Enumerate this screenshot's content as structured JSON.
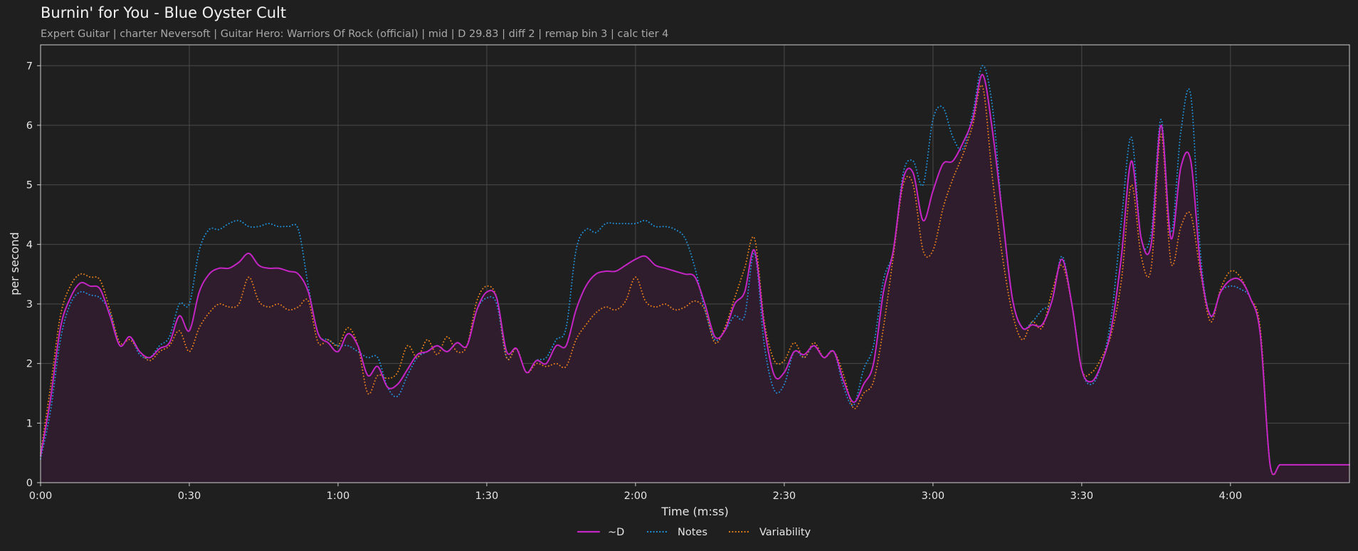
{
  "title": "Burnin' for You - Blue Oyster Cult",
  "subtitle": "Expert Guitar  |  charter Neversoft  |  Guitar Hero: Warriors Of Rock (official)  |  mid  |  D 29.83  |  diff 2  |  remap bin 3  |  calc tier 4",
  "colors": {
    "background": "#1f1f1f",
    "grid": "#4a4a4a",
    "d": "#c425c4",
    "notes": "#1f8fd6",
    "variability": "#e07b1c",
    "fill": "#2f1c2d"
  },
  "chart_data": {
    "type": "line",
    "xlabel": "Time (m:ss)",
    "ylabel": "per second",
    "xlim": [
      0,
      264
    ],
    "ylim": [
      0,
      7.35
    ],
    "x_ticks": [
      0,
      30,
      60,
      90,
      120,
      150,
      180,
      210,
      240
    ],
    "x_tick_labels": [
      "0:00",
      "0:30",
      "1:00",
      "1:30",
      "2:00",
      "2:30",
      "3:00",
      "3:30",
      "4:00"
    ],
    "y_ticks": [
      0,
      1,
      2,
      3,
      4,
      5,
      6,
      7
    ],
    "y_tick_labels": [
      "0",
      "1",
      "2",
      "3",
      "4",
      "5",
      "6",
      "7"
    ],
    "grid": true,
    "legend_position": "bottom-center",
    "x": [
      0,
      2,
      4,
      6,
      8,
      10,
      12,
      14,
      16,
      18,
      20,
      22,
      24,
      26,
      28,
      30,
      32,
      34,
      36,
      38,
      40,
      42,
      44,
      46,
      48,
      50,
      52,
      54,
      56,
      58,
      60,
      62,
      64,
      66,
      68,
      70,
      72,
      74,
      76,
      78,
      80,
      82,
      84,
      86,
      88,
      90,
      92,
      94,
      96,
      98,
      100,
      102,
      104,
      106,
      108,
      110,
      112,
      114,
      116,
      118,
      120,
      122,
      124,
      126,
      128,
      130,
      132,
      134,
      136,
      138,
      140,
      142,
      144,
      146,
      148,
      150,
      152,
      154,
      156,
      158,
      160,
      162,
      164,
      166,
      168,
      170,
      172,
      174,
      176,
      178,
      180,
      182,
      184,
      186,
      188,
      190,
      192,
      194,
      196,
      198,
      200,
      202,
      204,
      206,
      208,
      210,
      212,
      214,
      216,
      218,
      220,
      222,
      224,
      226,
      228,
      230,
      232,
      234,
      236,
      238,
      240,
      242,
      244,
      246,
      248,
      250,
      252,
      254,
      256,
      258,
      260,
      262,
      264
    ],
    "series": [
      {
        "name": "~D",
        "style": "solid",
        "fill": true,
        "values": [
          0.45,
          1.4,
          2.6,
          3.1,
          3.35,
          3.3,
          3.25,
          2.8,
          2.3,
          2.45,
          2.2,
          2.1,
          2.25,
          2.35,
          2.8,
          2.55,
          3.2,
          3.5,
          3.6,
          3.6,
          3.7,
          3.85,
          3.65,
          3.6,
          3.6,
          3.55,
          3.5,
          3.2,
          2.5,
          2.35,
          2.2,
          2.5,
          2.3,
          1.8,
          1.95,
          1.6,
          1.65,
          1.9,
          2.15,
          2.2,
          2.3,
          2.2,
          2.35,
          2.3,
          2.9,
          3.2,
          3.1,
          2.2,
          2.25,
          1.85,
          2.05,
          2.0,
          2.3,
          2.3,
          2.9,
          3.3,
          3.5,
          3.55,
          3.55,
          3.65,
          3.75,
          3.8,
          3.65,
          3.6,
          3.55,
          3.5,
          3.45,
          3.0,
          2.45,
          2.55,
          3.0,
          3.2,
          3.9,
          2.6,
          1.8,
          1.85,
          2.2,
          2.15,
          2.3,
          2.1,
          2.2,
          1.7,
          1.35,
          1.65,
          2.0,
          3.2,
          3.9,
          5.1,
          5.2,
          4.4,
          4.9,
          5.35,
          5.4,
          5.7,
          6.1,
          6.85,
          5.9,
          4.5,
          3.1,
          2.6,
          2.65,
          2.65,
          3.05,
          3.75,
          3.0,
          1.9,
          1.7,
          2.0,
          2.6,
          3.8,
          5.4,
          4.1,
          4.0,
          6.0,
          4.1,
          5.3,
          5.4,
          3.6,
          2.8,
          3.2,
          3.4,
          3.4,
          3.1,
          2.5,
          0.3,
          0.3,
          0.3,
          0.3,
          0.3,
          0.3,
          0.3,
          0.3,
          0.3
        ]
      },
      {
        "name": "Notes",
        "style": "dotted",
        "values": [
          0.4,
          1.2,
          2.4,
          3.0,
          3.2,
          3.15,
          3.1,
          2.85,
          2.3,
          2.45,
          2.15,
          2.1,
          2.3,
          2.45,
          3.0,
          3.0,
          3.9,
          4.25,
          4.25,
          4.35,
          4.4,
          4.3,
          4.3,
          4.35,
          4.3,
          4.3,
          4.25,
          3.3,
          2.5,
          2.4,
          2.3,
          2.3,
          2.2,
          2.1,
          2.1,
          1.6,
          1.45,
          1.8,
          2.1,
          2.2,
          2.3,
          2.2,
          2.35,
          2.3,
          2.9,
          3.1,
          3.0,
          2.1,
          2.25,
          1.85,
          2.05,
          2.1,
          2.4,
          2.6,
          3.9,
          4.25,
          4.2,
          4.35,
          4.35,
          4.35,
          4.35,
          4.4,
          4.3,
          4.3,
          4.25,
          4.1,
          3.6,
          2.9,
          2.4,
          2.55,
          2.8,
          2.8,
          3.85,
          2.3,
          1.55,
          1.65,
          2.2,
          2.1,
          2.3,
          2.1,
          2.2,
          1.6,
          1.3,
          1.9,
          2.3,
          3.4,
          3.9,
          5.2,
          5.4,
          5.0,
          6.1,
          6.3,
          5.8,
          5.6,
          6.2,
          7.0,
          6.3,
          4.5,
          3.1,
          2.6,
          2.7,
          2.9,
          3.05,
          3.8,
          3.0,
          1.9,
          1.65,
          2.0,
          2.8,
          4.4,
          5.8,
          4.1,
          4.2,
          6.1,
          4.2,
          5.9,
          6.5,
          3.8,
          2.8,
          3.2,
          3.3,
          3.25,
          3.1,
          2.5,
          0.3,
          0.3,
          0.3,
          0.3,
          0.3,
          0.3,
          0.3,
          0.3,
          0.3
        ]
      },
      {
        "name": "Variability",
        "style": "dotted",
        "values": [
          0.5,
          1.6,
          2.8,
          3.3,
          3.5,
          3.45,
          3.4,
          2.9,
          2.35,
          2.4,
          2.2,
          2.05,
          2.2,
          2.3,
          2.55,
          2.2,
          2.6,
          2.85,
          3.0,
          2.95,
          3.0,
          3.45,
          3.05,
          2.95,
          3.0,
          2.9,
          2.95,
          3.05,
          2.35,
          2.4,
          2.3,
          2.6,
          2.3,
          1.5,
          1.8,
          1.75,
          1.85,
          2.3,
          2.1,
          2.4,
          2.15,
          2.45,
          2.2,
          2.3,
          3.05,
          3.3,
          3.1,
          2.1,
          2.25,
          1.85,
          2.0,
          1.95,
          2.0,
          1.95,
          2.4,
          2.65,
          2.85,
          2.95,
          2.9,
          3.05,
          3.45,
          3.05,
          2.95,
          3.0,
          2.9,
          2.95,
          3.05,
          2.9,
          2.35,
          2.6,
          3.1,
          3.6,
          4.1,
          2.7,
          2.05,
          2.05,
          2.35,
          2.1,
          2.35,
          2.1,
          2.2,
          1.8,
          1.25,
          1.5,
          1.7,
          2.6,
          3.8,
          5.0,
          5.0,
          3.9,
          3.9,
          4.6,
          5.1,
          5.5,
          6.0,
          6.65,
          5.1,
          3.8,
          2.85,
          2.4,
          2.7,
          2.6,
          3.2,
          3.65,
          3.0,
          1.9,
          1.85,
          2.1,
          2.5,
          3.4,
          5.0,
          3.8,
          3.6,
          5.85,
          3.7,
          4.3,
          4.5,
          3.5,
          2.7,
          3.25,
          3.55,
          3.45,
          3.1,
          2.6,
          0.3,
          0.3,
          0.3,
          0.3,
          0.3,
          0.3,
          0.3,
          0.3,
          0.3
        ]
      }
    ]
  }
}
